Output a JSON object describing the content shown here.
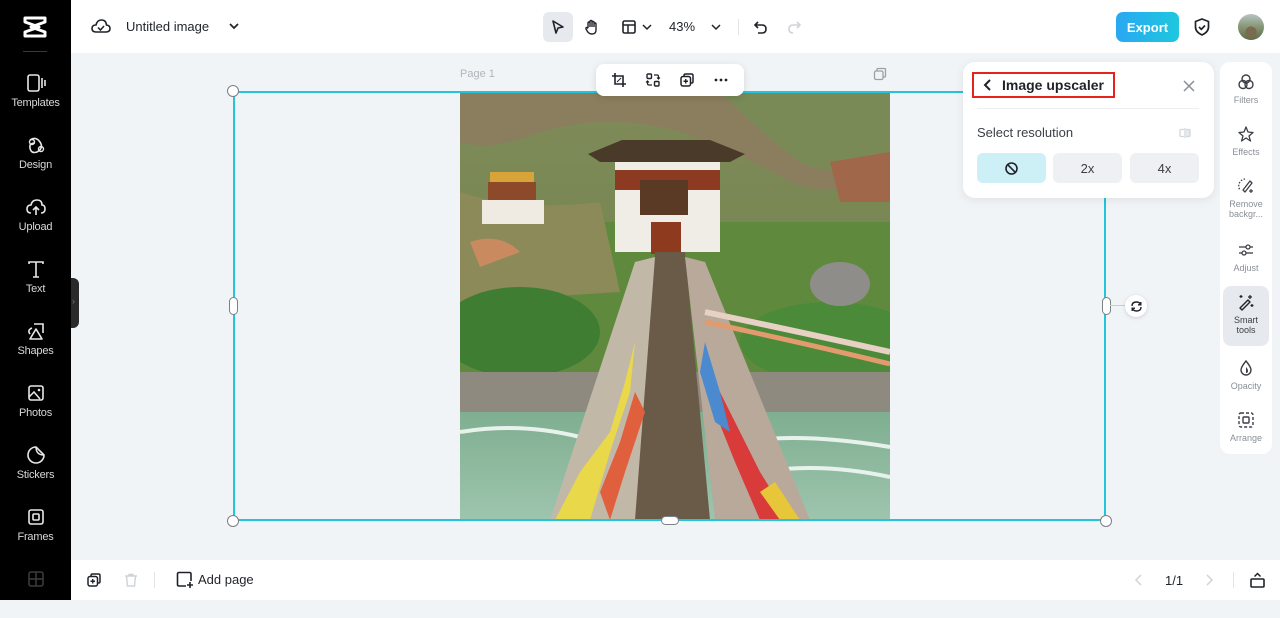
{
  "app": {
    "logo": "capcut-logo"
  },
  "sidebar": {
    "items": [
      {
        "label": "Templates",
        "icon": "templates-icon"
      },
      {
        "label": "Design",
        "icon": "design-icon"
      },
      {
        "label": "Upload",
        "icon": "upload-icon"
      },
      {
        "label": "Text",
        "icon": "text-icon"
      },
      {
        "label": "Shapes",
        "icon": "shapes-icon"
      },
      {
        "label": "Photos",
        "icon": "photos-icon"
      },
      {
        "label": "Stickers",
        "icon": "stickers-icon"
      },
      {
        "label": "Frames",
        "icon": "frames-icon"
      }
    ]
  },
  "header": {
    "document_title": "Untitled image",
    "zoom": "43%",
    "export_label": "Export"
  },
  "canvas": {
    "page_label": "Page 1",
    "image_subject": "Suspension bridge with prayer flags leading to a Bhutanese temple"
  },
  "upscaler_panel": {
    "title": "Image upscaler",
    "subtitle": "Select resolution",
    "options": [
      {
        "label": "",
        "icon": "none-icon",
        "selected": true
      },
      {
        "label": "2x",
        "selected": false
      },
      {
        "label": "4x",
        "selected": false
      }
    ],
    "colors": {
      "selected_bg": "#cdeff6",
      "highlight_border": "#e5221c"
    }
  },
  "right_rail": {
    "items": [
      {
        "label": "Filters"
      },
      {
        "label": "Effects"
      },
      {
        "label": "Remove backgr..."
      },
      {
        "label": "Adjust"
      },
      {
        "label": "Smart tools",
        "active": true
      },
      {
        "label": "Opacity"
      },
      {
        "label": "Arrange"
      }
    ]
  },
  "footer": {
    "add_page_label": "Add page",
    "pagination": "1/1"
  },
  "colors": {
    "accent": "#22c5d9",
    "export_gradient_start": "#29a8f2",
    "export_gradient_end": "#1ec7de"
  }
}
